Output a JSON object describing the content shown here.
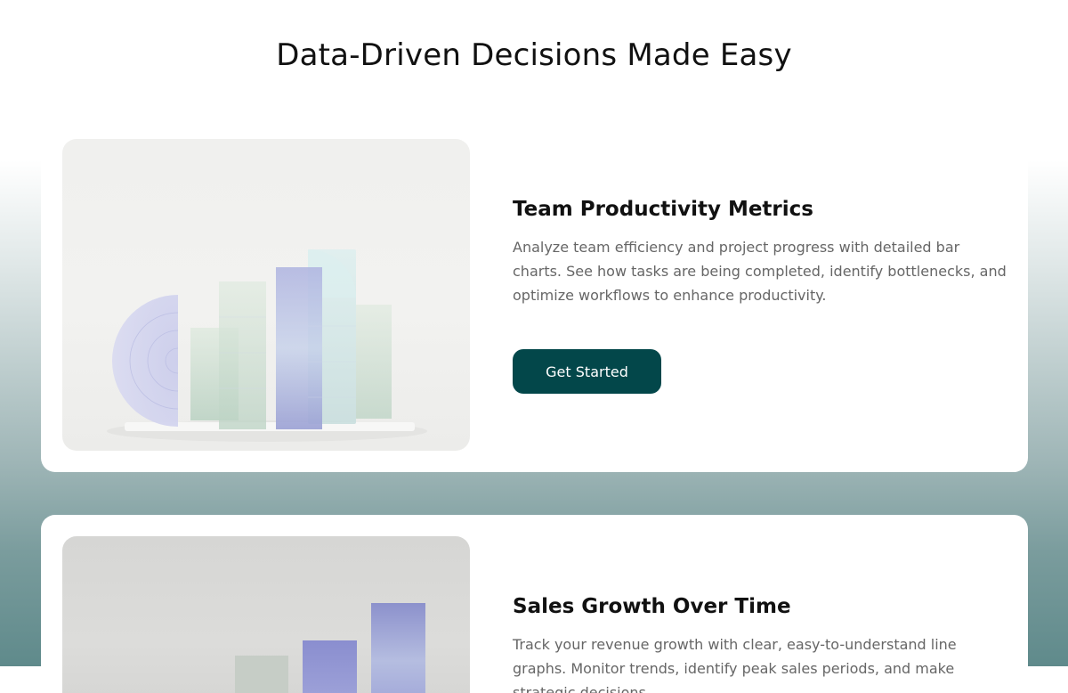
{
  "page": {
    "title": "Data-Driven Decisions Made Easy"
  },
  "cards": [
    {
      "title": "Team Productivity Metrics",
      "description": "Analyze team efficiency and project progress with detailed bar charts. See how tasks are being completed, identify bottlenecks, and optimize workflows to enhance productivity.",
      "button_label": "Get Started"
    },
    {
      "title": "Sales Growth Over Time",
      "description": "Track your revenue growth with clear, easy-to-understand line graphs. Monitor trends, identify peak sales periods, and make strategic decisions."
    }
  ],
  "colors": {
    "button_bg": "#03474a",
    "button_text": "#ffffff",
    "gradient_bottom": "#5f8a8b"
  }
}
